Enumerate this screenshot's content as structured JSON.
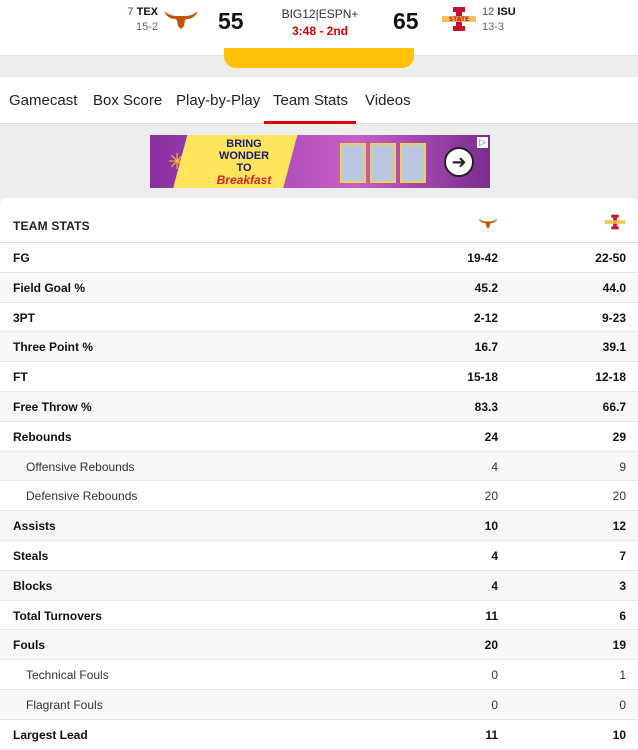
{
  "scoreboard": {
    "away": {
      "rank": "7",
      "abbr": "TEX",
      "record": "15-2",
      "score": "55",
      "color": "#bf5700"
    },
    "home": {
      "rank": "12",
      "abbr": "ISU",
      "record": "13-3",
      "score": "65",
      "color": "#c8102e"
    },
    "network": "BIG12|ESPN+",
    "clock": "3:48 - 2nd"
  },
  "tabs": [
    {
      "label": "Gamecast"
    },
    {
      "label": "Box Score"
    },
    {
      "label": "Play-by-Play"
    },
    {
      "label": "Team Stats",
      "active": true
    },
    {
      "label": "Videos"
    }
  ],
  "ad": {
    "line1": "BRING",
    "line2": "WONDER",
    "line3": "TO",
    "line4": "Breakfast",
    "icon": "arrow-right-icon"
  },
  "stats": {
    "title": "TEAM STATS",
    "rows": [
      {
        "label": "FG",
        "away": "19-42",
        "home": "22-50",
        "sub": false
      },
      {
        "label": "Field Goal %",
        "away": "45.2",
        "home": "44.0",
        "sub": false
      },
      {
        "label": "3PT",
        "away": "2-12",
        "home": "9-23",
        "sub": false
      },
      {
        "label": "Three Point %",
        "away": "16.7",
        "home": "39.1",
        "sub": false
      },
      {
        "label": "FT",
        "away": "15-18",
        "home": "12-18",
        "sub": false
      },
      {
        "label": "Free Throw %",
        "away": "83.3",
        "home": "66.7",
        "sub": false
      },
      {
        "label": "Rebounds",
        "away": "24",
        "home": "29",
        "sub": false
      },
      {
        "label": "Offensive Rebounds",
        "away": "4",
        "home": "9",
        "sub": true
      },
      {
        "label": "Defensive Rebounds",
        "away": "20",
        "home": "20",
        "sub": true
      },
      {
        "label": "Assists",
        "away": "10",
        "home": "12",
        "sub": false
      },
      {
        "label": "Steals",
        "away": "4",
        "home": "7",
        "sub": false
      },
      {
        "label": "Blocks",
        "away": "4",
        "home": "3",
        "sub": false
      },
      {
        "label": "Total Turnovers",
        "away": "11",
        "home": "6",
        "sub": false
      },
      {
        "label": "Fouls",
        "away": "20",
        "home": "19",
        "sub": false
      },
      {
        "label": "Technical Fouls",
        "away": "0",
        "home": "1",
        "sub": true
      },
      {
        "label": "Flagrant Fouls",
        "away": "0",
        "home": "0",
        "sub": true
      },
      {
        "label": "Largest Lead",
        "away": "11",
        "home": "10",
        "sub": false
      }
    ]
  }
}
